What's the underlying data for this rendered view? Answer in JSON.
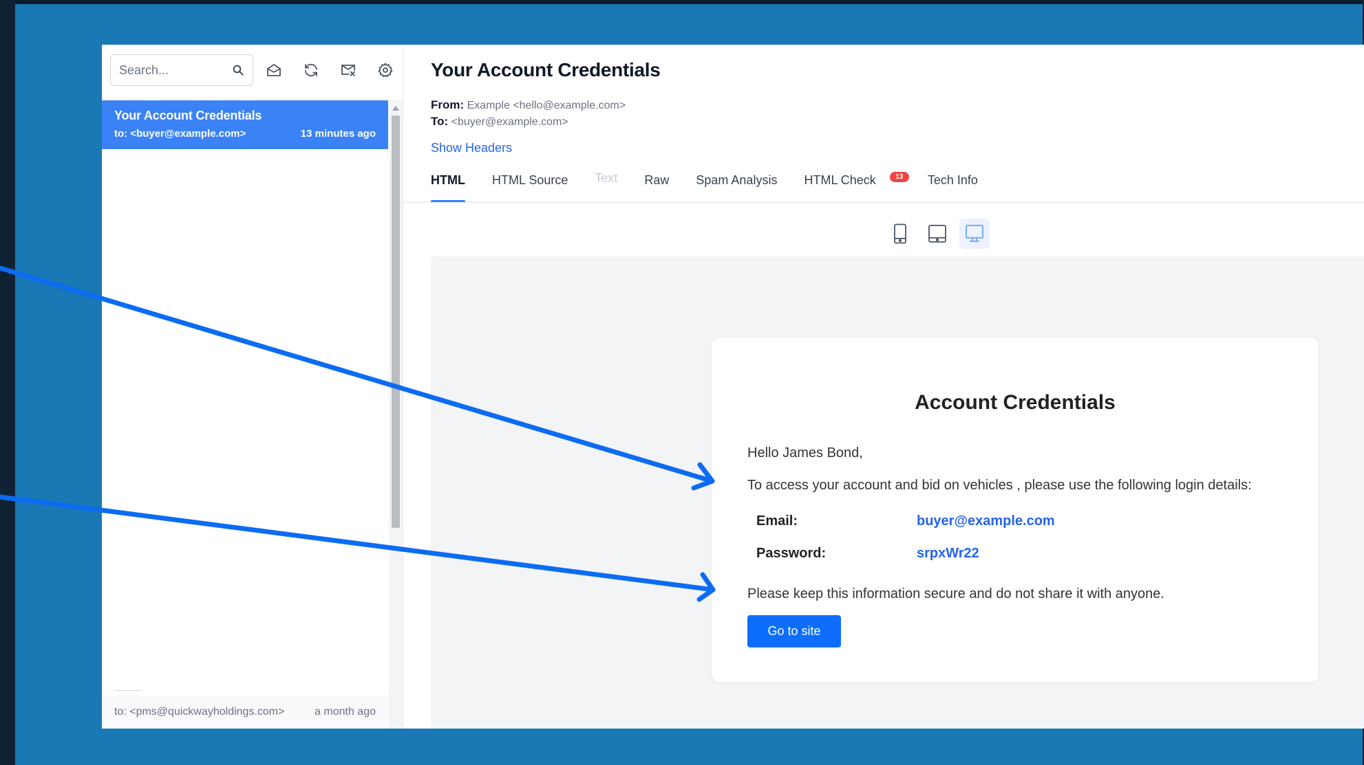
{
  "sidebar": {
    "search": {
      "placeholder": "Search..."
    },
    "toolbar_icons": [
      "search-icon",
      "mark-read-icon",
      "refresh-icon",
      "clear-inbox-icon",
      "gear-icon"
    ],
    "messages": [
      {
        "subject": "Your Account Credentials",
        "to": "to: <buyer@example.com>",
        "time": "13 minutes ago",
        "active": true
      }
    ],
    "footer_item": {
      "to": "to: <pms@quickwayholdings.com>",
      "time": "a month ago"
    }
  },
  "email": {
    "title": "Your Account Credentials",
    "from_label": "From:",
    "from_value": "Example <hello@example.com>",
    "to_label": "To:",
    "to_value": "<buyer@example.com>",
    "show_headers": "Show Headers",
    "tabs": [
      {
        "label": "HTML",
        "active": true
      },
      {
        "label": "HTML Source"
      },
      {
        "label": "Text",
        "disabled": true
      },
      {
        "label": "Raw"
      },
      {
        "label": "Spam Analysis"
      },
      {
        "label": "HTML Check",
        "badge": "13"
      },
      {
        "label": "Tech Info"
      }
    ],
    "device_icons": [
      "mobile-icon",
      "tablet-icon",
      "desktop-icon"
    ],
    "active_device": "desktop-icon"
  },
  "preview": {
    "heading": "Account Credentials",
    "greeting": "Hello James Bond,",
    "intro": "To access your account and bid on vehicles , please use the following login details:",
    "email_label": "Email:",
    "email_value": "buyer@example.com",
    "password_label": "Password:",
    "password_value": "srpxWr22",
    "note": "Please keep this information secure and do not share it with anyone.",
    "button": "Go to site"
  },
  "colors": {
    "background": "#1a78b5",
    "accent": "#3b82f6",
    "link": "#2563eb",
    "button": "#0d6efd",
    "annotation_arrow": "#0b6cf2",
    "badge": "#ef4444"
  }
}
